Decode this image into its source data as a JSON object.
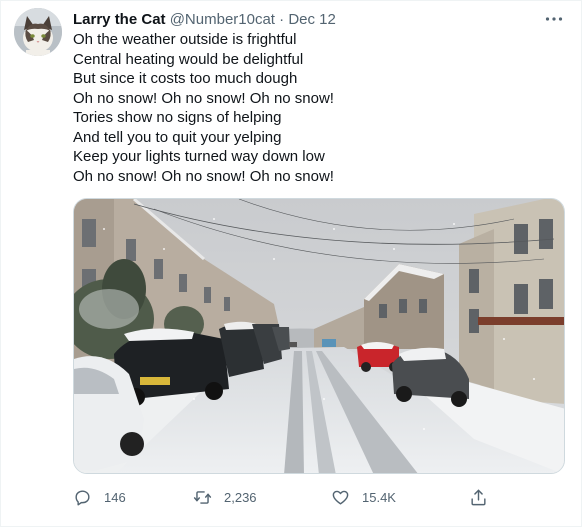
{
  "tweet": {
    "author_name": "Larry the Cat",
    "handle": "@Number10cat",
    "separator": "·",
    "date": "Dec 12",
    "lines": [
      "Oh the weather outside is frightful",
      "Central heating would be delightful",
      "But since it costs too much dough",
      "Oh no snow! Oh no snow! Oh no snow!",
      "Tories show no signs of helping",
      "And tell you to quit your yelping",
      "Keep your lights turned way down low",
      "Oh no snow! Oh no snow! Oh no snow!"
    ],
    "media_description_icon": "snowy-street-photo"
  },
  "actions": {
    "replies": "146",
    "retweets": "2,236",
    "likes": "15.4K",
    "reply_icon": "reply-icon",
    "retweet_icon": "retweet-icon",
    "like_icon": "heart-icon",
    "share_icon": "share-icon"
  },
  "colors": {
    "text": "#0f1419",
    "secondary": "#536471",
    "border": "#cfd9de"
  }
}
